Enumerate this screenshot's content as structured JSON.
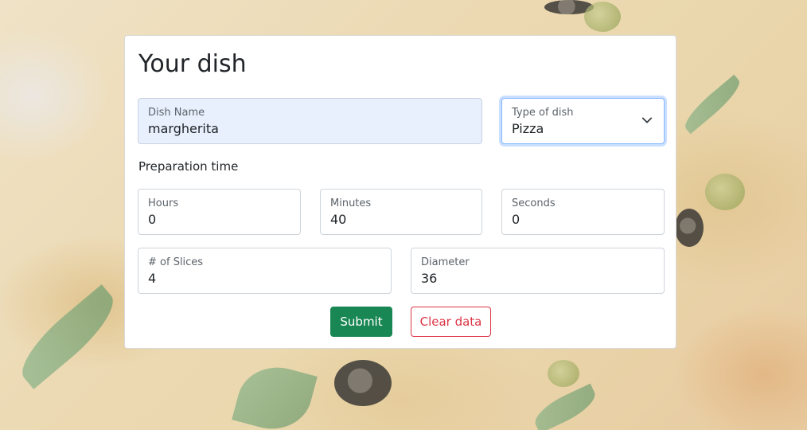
{
  "form": {
    "title": "Your dish",
    "dish_name": {
      "label": "Dish Name",
      "value": "margherita"
    },
    "type_of_dish": {
      "label": "Type of dish",
      "value": "Pizza"
    },
    "preparation_time_label": "Preparation time",
    "hours": {
      "label": "Hours",
      "value": "0"
    },
    "minutes": {
      "label": "Minutes",
      "value": "40"
    },
    "seconds": {
      "label": "Seconds",
      "value": "0"
    },
    "slices": {
      "label": "# of Slices",
      "value": "4"
    },
    "diameter": {
      "label": "Diameter",
      "value": "36"
    },
    "submit_label": "Submit",
    "clear_label": "Clear data"
  },
  "colors": {
    "submit": "#198754",
    "clear": "#dc3545",
    "autofill": "#e8f0fe",
    "focus": "#86b7fe"
  },
  "icons": {
    "select_arrow": "chevron-down-icon"
  }
}
